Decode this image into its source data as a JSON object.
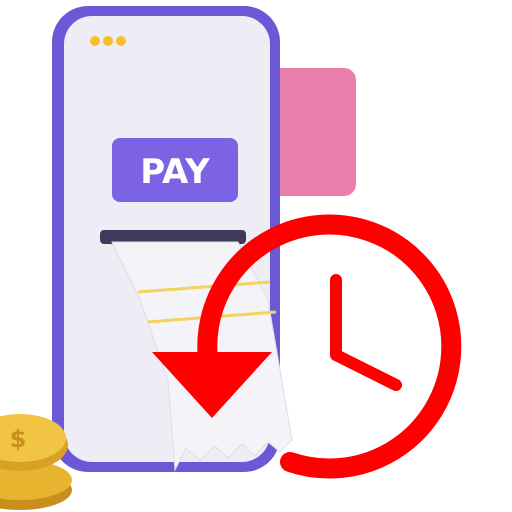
{
  "illustration": {
    "pay_button_label": "PAY",
    "colors": {
      "phone_frame": "#6a58d6",
      "phone_screen": "#eeedf6",
      "pay_button": "#7b63e3",
      "card": "#ea7eac",
      "dots": "#f5c02a",
      "receipt": "#f4f4f8",
      "receipt_lines": "#f3d35c",
      "clock_arrow": "#ff0000",
      "coins": "#e9b430"
    },
    "icons": [
      "phone-icon",
      "credit-card-icon",
      "receipt-icon",
      "history-clock-icon",
      "coins-icon"
    ]
  }
}
